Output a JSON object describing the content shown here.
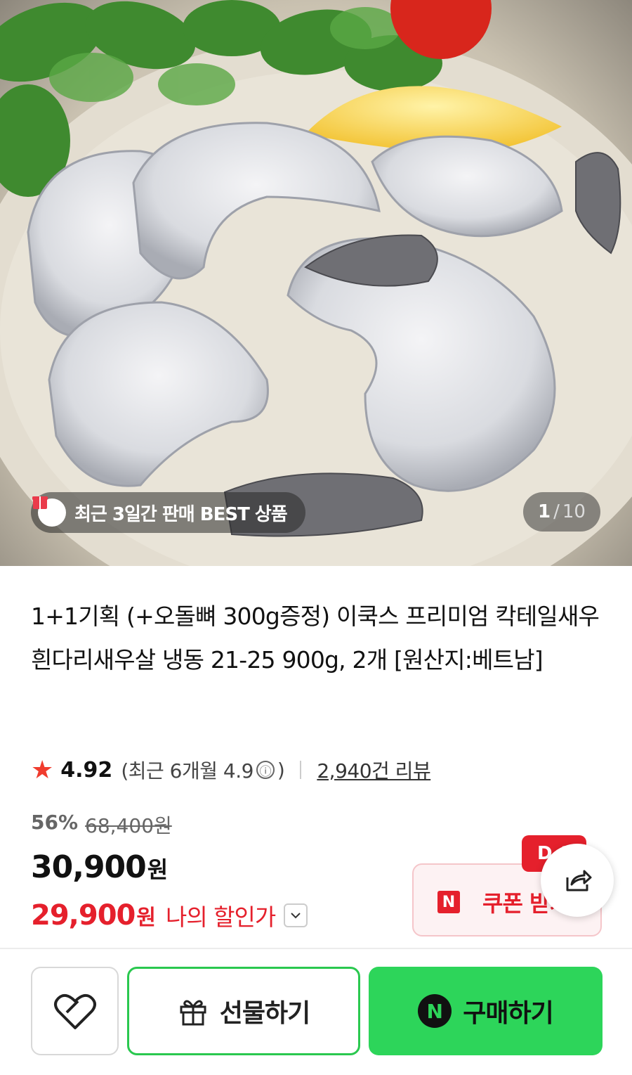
{
  "gallery": {
    "badge_text": "최근 3일간 판매 BEST 상품",
    "current": "1",
    "separator": "/",
    "total": "10"
  },
  "product": {
    "title": "1+1기획 (+오돌뼈 300g증정) 이쿡스 프리미엄 칵테일새우 흰다리새우살 냉동 21-25 900g, 2개 [원산지:베트남]"
  },
  "rating": {
    "score": "4.92",
    "recent_prefix": "(최근 6개월 4.9",
    "recent_suffix": ")",
    "info_icon": "ⓘ",
    "reviews": "2,940건 리뷰"
  },
  "pricing": {
    "discount_rate": "56%",
    "original_price": "68,400원",
    "price": "30,900",
    "price_unit": "원",
    "my_price": "29,900",
    "my_price_unit": "원",
    "my_price_label": "나의 할인가"
  },
  "coupon": {
    "dday": "D-1",
    "naver_mark": "N",
    "label": "쿠폰 받기"
  },
  "actions": {
    "gift_label": "선물하기",
    "buy_mark": "N",
    "buy_label": "구매하기"
  },
  "colors": {
    "accent_red": "#e5202c",
    "buy_green": "#2dd55a",
    "star": "#f03c2e"
  }
}
